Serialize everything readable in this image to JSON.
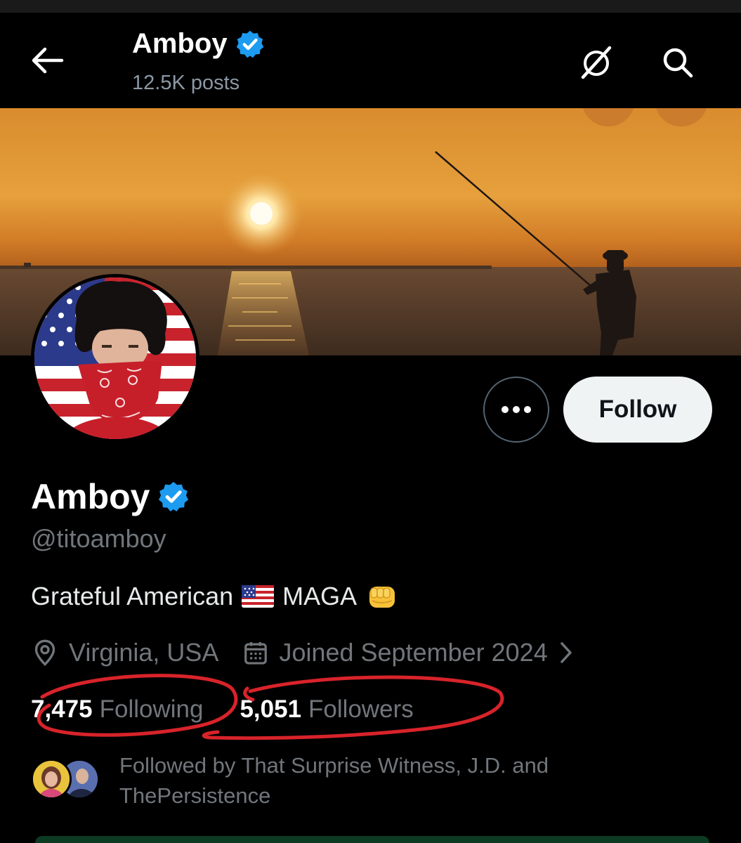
{
  "header": {
    "name": "Amboy",
    "posts_count": "12.5K posts",
    "back_icon": "arrow-left-icon",
    "grok_icon": "grok-icon",
    "search_icon": "search-icon"
  },
  "profile": {
    "display_name": "Amboy",
    "verified": true,
    "handle": "@titoamboy",
    "bio_text_1": "Grateful American",
    "bio_text_2": "MAGA",
    "bio_emoji_flag": "🇺🇸",
    "bio_emoji_fist": "👊",
    "location": "Virginia, USA",
    "joined": "Joined September 2024",
    "following_count": "7,475",
    "following_label": "Following",
    "followers_count": "5,051",
    "followers_label": "Followers",
    "followed_by": "Followed by That Surprise Witness, J.D. and ThePersistence"
  },
  "actions": {
    "more_icon": "more-icon",
    "follow_label": "Follow"
  },
  "colors": {
    "background": "#000000",
    "verified_blue": "#1d9bf0",
    "muted_text": "#71767b",
    "follow_button_bg": "#eff3f4",
    "annotation_red": "#d8232a"
  }
}
